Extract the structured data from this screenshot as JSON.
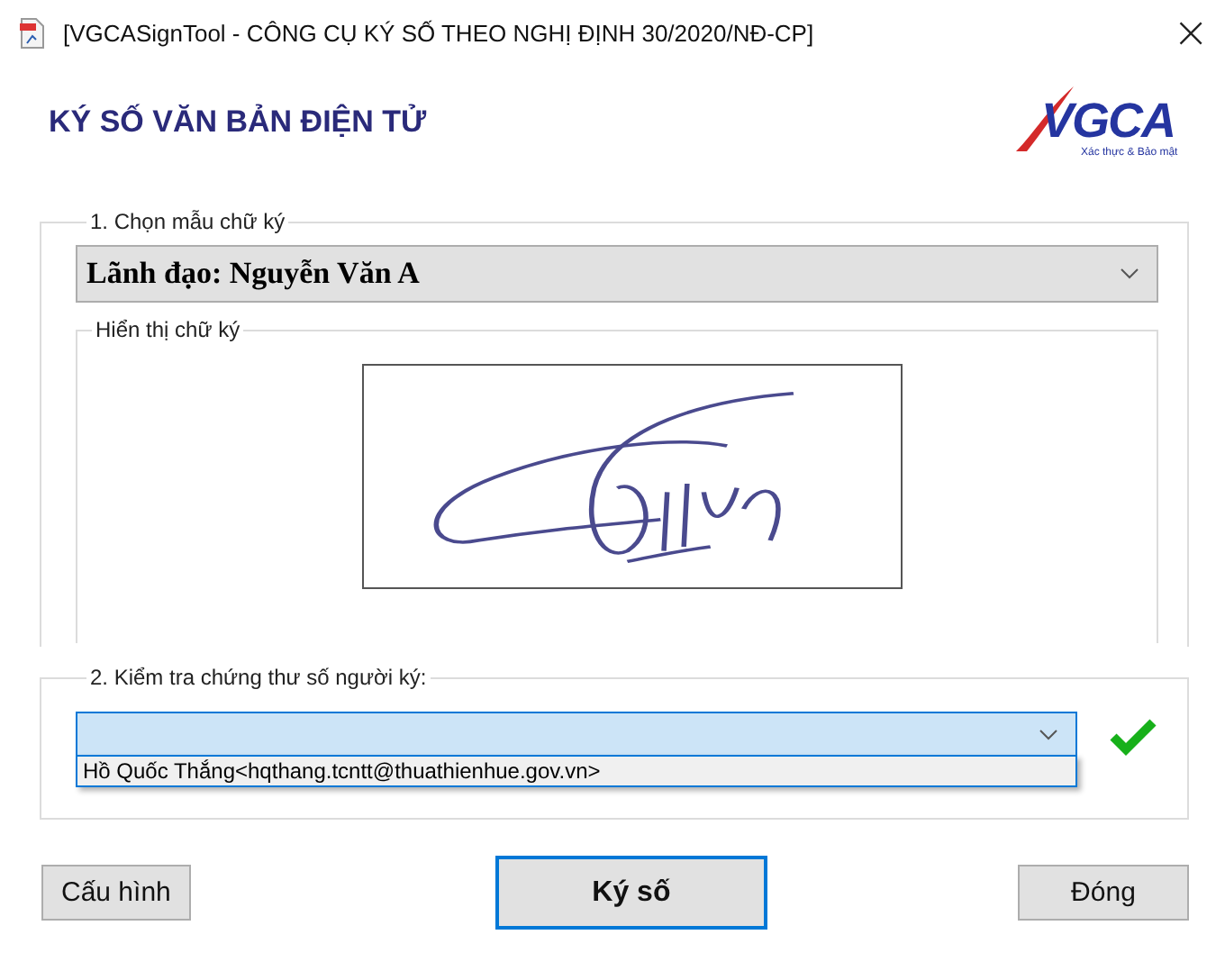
{
  "window": {
    "title": "[VGCASignTool - CÔNG CỤ KÝ SỐ THEO NGHỊ ĐỊNH 30/2020/NĐ-CP]",
    "close": "×"
  },
  "heading": "KÝ SỐ VĂN BẢN ĐIỆN TỬ",
  "logo": {
    "text": "VGCA",
    "tagline": "Xác thực & Bảo mật"
  },
  "signature_group": {
    "legend": "1. Chọn mẫu chữ ký",
    "template_select": {
      "value": "Lãnh đạo: Nguyễn Văn A"
    },
    "preview": {
      "legend": "Hiển thị chữ ký"
    }
  },
  "certificate_group": {
    "legend": "2. Kiểm tra chứng thư số người ký:",
    "select": {
      "expanded": true,
      "verified": true
    },
    "options": [
      {
        "text": "Hồ Quốc Thắng<hqthang.tcntt@thuathienhue.gov.vn>",
        "selected": false
      }
    ]
  },
  "buttons": [
    {
      "label": "Cấu hình",
      "kind": "default"
    },
    {
      "label": "Ký số",
      "kind": "primary"
    },
    {
      "label": "Đóng",
      "kind": "default"
    }
  ]
}
